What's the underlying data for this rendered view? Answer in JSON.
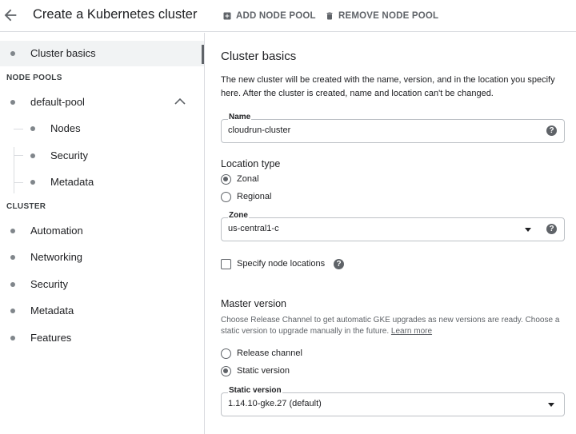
{
  "header": {
    "title": "Create a Kubernetes cluster",
    "add_node_pool": "ADD NODE POOL",
    "remove_node_pool": "REMOVE NODE POOL"
  },
  "sidebar": {
    "cluster_basics": "Cluster basics",
    "node_pools_heading": "NODE POOLS",
    "default_pool": "default-pool",
    "pool_items": [
      "Nodes",
      "Security",
      "Metadata"
    ],
    "cluster_heading": "CLUSTER",
    "cluster_items": [
      "Automation",
      "Networking",
      "Security",
      "Metadata",
      "Features"
    ]
  },
  "main": {
    "title": "Cluster basics",
    "description": "The new cluster will be created with the name, version, and in the location you specify here. After the cluster is created, name and location can't be changed.",
    "name_field": {
      "label": "Name",
      "value": "cloudrun-cluster"
    },
    "location_type": {
      "heading": "Location type",
      "options": [
        "Zonal",
        "Regional"
      ],
      "selected": "Zonal"
    },
    "zone_field": {
      "label": "Zone",
      "value": "us-central1-c"
    },
    "specify_node_locations": {
      "label": "Specify node locations",
      "checked": false
    },
    "master_version": {
      "heading": "Master version",
      "description": "Choose Release Channel to get automatic GKE upgrades as new versions are ready. Choose a static version to upgrade manually in the future.",
      "learn_more": "Learn more",
      "options": [
        "Release channel",
        "Static version"
      ],
      "selected": "Static version"
    },
    "static_version_field": {
      "label": "Static version",
      "value": "1.14.10-gke.27 (default)"
    }
  },
  "icons": {
    "back": "arrow-left-icon",
    "add": "add-box-icon",
    "remove": "trash-icon",
    "help": "help-circle-icon",
    "dropdown": "caret-down-icon",
    "collapse": "chevron-up-icon"
  },
  "colors": {
    "text": "#202124",
    "secondary": "#5f6368",
    "border": "#dadce0",
    "active_bg": "#f1f3f4"
  }
}
